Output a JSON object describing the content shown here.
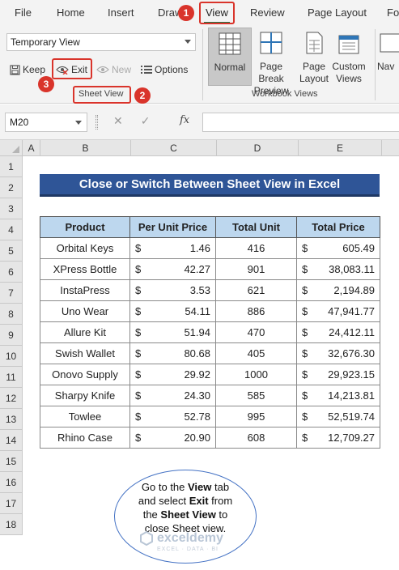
{
  "ribbon_tabs": [
    "File",
    "Home",
    "Insert",
    "Draw",
    "View",
    "Review",
    "Page Layout",
    "Fo"
  ],
  "active_tab": "View",
  "sheet_view": {
    "combo_value": "Temporary View",
    "keep_label": "Keep",
    "exit_label": "Exit",
    "new_label": "New",
    "options_label": "Options",
    "group_label": "Sheet View"
  },
  "workbook_views": {
    "normal_label": "Normal",
    "page_break_label": [
      "Page Break",
      "Preview"
    ],
    "page_layout_label": [
      "Page",
      "Layout"
    ],
    "custom_views_label": [
      "Custom",
      "Views"
    ],
    "nav_label": "Nav",
    "group_label": "Workbook Views"
  },
  "formula_bar": {
    "name_box": "M20",
    "cancel_icon": "✕",
    "enter_icon": "✓",
    "fx_label": "fx",
    "formula": ""
  },
  "columns": [
    "A",
    "B",
    "C",
    "D",
    "E"
  ],
  "rows": [
    "1",
    "2",
    "3",
    "4",
    "5",
    "6",
    "7",
    "8",
    "9",
    "10",
    "11",
    "12",
    "13",
    "14",
    "15",
    "16",
    "17",
    "18"
  ],
  "sheet_title": "Close or Switch Between Sheet View in Excel",
  "table": {
    "headers": [
      "Product",
      "Per Unit Price",
      "Total Unit",
      "Total Price"
    ],
    "currency": "$",
    "rows": [
      [
        "Orbital Keys",
        "1.46",
        "416",
        "605.49"
      ],
      [
        "XPress Bottle",
        "42.27",
        "901",
        "38,083.11"
      ],
      [
        "InstaPress",
        "3.53",
        "621",
        "2,194.89"
      ],
      [
        "Uno Wear",
        "54.11",
        "886",
        "47,941.77"
      ],
      [
        "Allure Kit",
        "51.94",
        "470",
        "24,412.11"
      ],
      [
        "Swish Wallet",
        "80.68",
        "405",
        "32,676.30"
      ],
      [
        "Onovo Supply",
        "29.92",
        "1000",
        "29,923.15"
      ],
      [
        "Sharpy Knife",
        "24.30",
        "585",
        "14,213.81"
      ],
      [
        "Towlee",
        "52.78",
        "995",
        "52,519.74"
      ],
      [
        "Rhino Case",
        "20.90",
        "608",
        "12,709.27"
      ]
    ]
  },
  "callout": {
    "l1a": "Go to the ",
    "l1b": "View",
    "l1c": " tab",
    "l2a": "and select ",
    "l2b": "Exit",
    "l2c": " from",
    "l3a": "the ",
    "l3b": "Sheet View",
    "l3c": " to",
    "l4": "close Sheet view."
  },
  "step_badges": [
    "1",
    "2",
    "3"
  ],
  "watermark": {
    "name": "exceldemy",
    "tagline": "EXCEL · DATA · BI"
  },
  "colors": {
    "accent": "#217346",
    "annotation": "#d9342b",
    "title_bg": "#2f5597",
    "header_bg": "#bdd7ee"
  }
}
